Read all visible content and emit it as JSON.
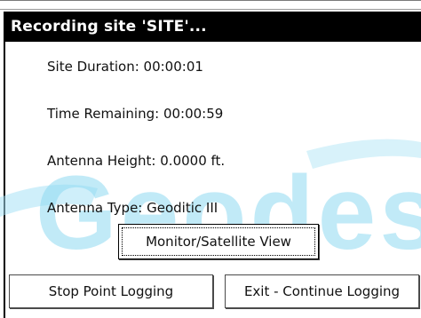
{
  "dialog": {
    "title": "Recording site 'SITE'..."
  },
  "info": {
    "site_duration": "Site Duration: 00:00:01",
    "time_remaining": "Time Remaining: 00:00:59",
    "antenna_height": "Antenna Height: 0.0000 ft.",
    "antenna_type": "Antenna Type: Geoditic III"
  },
  "buttons": {
    "monitor": "Monitor/Satellite View",
    "stop": "Stop Point Logging",
    "exit": "Exit - Continue Logging"
  },
  "watermark": {
    "text": "Geodes",
    "color": "#7fd3ef"
  },
  "colors": {
    "title_bar": "#000000",
    "background": "#ffffff"
  }
}
